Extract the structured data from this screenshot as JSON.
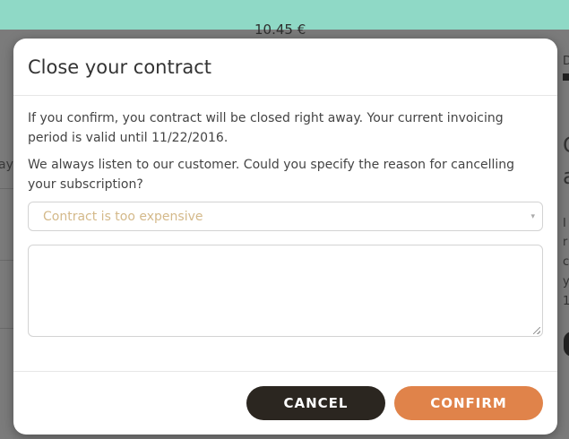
{
  "background": {
    "price": "10.45 €",
    "left_fragment": "ay",
    "right_fragments": [
      "D",
      "C",
      "a"
    ],
    "right_small_lines": [
      "I",
      "r",
      "c",
      "y",
      "1"
    ]
  },
  "modal": {
    "title": "Close your contract",
    "paragraph1": "If you confirm, you contract will be closed right away. Your current invoicing period is valid until 11/22/2016.",
    "paragraph2": "We always listen to our customer. Could you specify the reason for cancelling your subscription?",
    "reason_select": {
      "selected": "Contract is too expensive",
      "caret": "▾"
    },
    "comment_textarea": {
      "value": ""
    },
    "buttons": {
      "cancel": "CANCEL",
      "confirm": "CONFIRM"
    }
  },
  "colors": {
    "topbar": "#8fd9c6",
    "cancel_button": "#2b2620",
    "confirm_button": "#e0834a",
    "select_text": "#d4b98a"
  }
}
